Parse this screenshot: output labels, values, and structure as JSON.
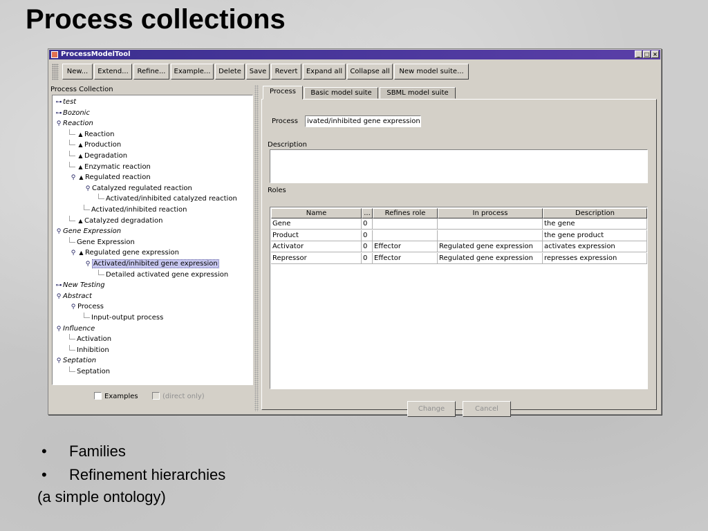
{
  "slide": {
    "title": "Process collections",
    "bullets": [
      "Families",
      "Refinement hierarchies"
    ],
    "note": "(a simple ontology)"
  },
  "window": {
    "title": "ProcessModelTool",
    "controls": [
      "_",
      "□",
      "×"
    ]
  },
  "toolbar": {
    "buttons": [
      "New...",
      "Extend...",
      "Refine...",
      "Example...",
      "Delete",
      "Save",
      "Revert",
      "Expand all",
      "Collapse all",
      "New model suite..."
    ]
  },
  "left_panel": {
    "label": "Process Collection",
    "tree": [
      {
        "label": "test",
        "level": 0,
        "toggle": "collapsed",
        "italic": true
      },
      {
        "label": "Bozonic",
        "level": 0,
        "toggle": "collapsed",
        "italic": true
      },
      {
        "label": "Reaction",
        "level": 0,
        "toggle": "expanded",
        "italic": true
      },
      {
        "label": "Reaction",
        "level": 1,
        "icon": "triangle"
      },
      {
        "label": "Production",
        "level": 1,
        "icon": "triangle"
      },
      {
        "label": "Degradation",
        "level": 1,
        "icon": "triangle"
      },
      {
        "label": "Enzymatic reaction",
        "level": 1,
        "icon": "triangle"
      },
      {
        "label": "Regulated reaction",
        "level": 1,
        "icon": "triangle",
        "toggle": "expanded"
      },
      {
        "label": "Catalyzed regulated reaction",
        "level": 2,
        "toggle": "expanded"
      },
      {
        "label": "Activated/inhibited catalyzed reaction",
        "level": 3
      },
      {
        "label": "Activated/inhibited reaction",
        "level": 2
      },
      {
        "label": "Catalyzed degradation",
        "level": 1,
        "icon": "triangle"
      },
      {
        "label": "Gene Expression",
        "level": 0,
        "toggle": "expanded",
        "italic": true
      },
      {
        "label": "Gene Expression",
        "level": 1
      },
      {
        "label": "Regulated gene expression",
        "level": 1,
        "icon": "triangle",
        "toggle": "expanded"
      },
      {
        "label": "Activated/inhibited gene expression",
        "level": 2,
        "toggle": "expanded",
        "selected": true
      },
      {
        "label": "Detailed activated gene expression",
        "level": 3
      },
      {
        "label": "New Testing",
        "level": 0,
        "toggle": "collapsed",
        "italic": true
      },
      {
        "label": "Abstract",
        "level": 0,
        "toggle": "expanded",
        "italic": true
      },
      {
        "label": "Process",
        "level": 1,
        "toggle": "expanded"
      },
      {
        "label": "Input-output process",
        "level": 2
      },
      {
        "label": "Influence",
        "level": 0,
        "toggle": "expanded",
        "italic": true
      },
      {
        "label": "Activation",
        "level": 1
      },
      {
        "label": "Inhibition",
        "level": 1
      },
      {
        "label": "Septation",
        "level": 0,
        "toggle": "expanded",
        "italic": true
      },
      {
        "label": "Septation",
        "level": 1
      }
    ],
    "examples_label": "Examples",
    "direct_only_label": "(direct only)"
  },
  "tabs": [
    "Process",
    "Basic model suite",
    "SBML model suite"
  ],
  "process_tab": {
    "process_label": "Process",
    "process_value": "ivated/inhibited gene expression",
    "description_label": "Description",
    "description_value": "",
    "roles_label": "Roles",
    "roles_columns": [
      "Name",
      "...",
      "Refines role",
      "In process",
      "Description"
    ],
    "roles_rows": [
      [
        "Gene",
        "0",
        "",
        "",
        "the gene"
      ],
      [
        "Product",
        "0",
        "",
        "",
        "the gene product"
      ],
      [
        "Activator",
        "0",
        "Effector",
        "Regulated gene expression",
        "activates expression"
      ],
      [
        "Repressor",
        "0",
        "Effector",
        "Regulated gene expression",
        "represses expression"
      ]
    ],
    "change_label": "Change",
    "cancel_label": "Cancel"
  },
  "icons": {
    "collapsed": "⊶",
    "expanded": "⚲",
    "triangle": "▲"
  }
}
